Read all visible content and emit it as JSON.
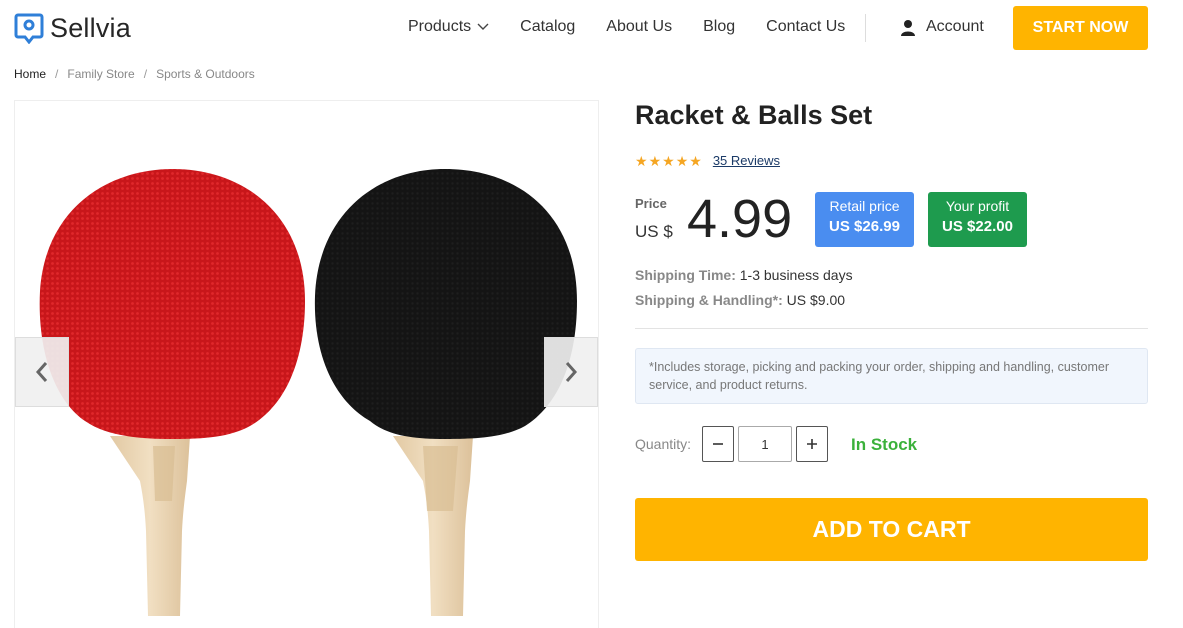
{
  "brand": {
    "name": "Sellvia",
    "color": "#2f7fd8"
  },
  "nav": {
    "items": [
      {
        "label": "Products",
        "has_dropdown": true
      },
      {
        "label": "Catalog"
      },
      {
        "label": "About Us"
      },
      {
        "label": "Blog"
      },
      {
        "label": "Contact Us"
      }
    ],
    "account_label": "Account",
    "start_label": "START NOW"
  },
  "breadcrumb": [
    "Home",
    "Family Store",
    "Sports & Outdoors"
  ],
  "product": {
    "title": "Racket & Balls Set",
    "rating": 5,
    "reviews_label": "35 Reviews",
    "price_label": "Price",
    "currency": "US $",
    "price": "4.99",
    "retail": {
      "label": "Retail price",
      "value": "US $26.99",
      "color": "#4a8df0"
    },
    "profit": {
      "label": "Your profit",
      "value": "US $22.00",
      "color": "#1e9b4e"
    },
    "shipping_time_label": "Shipping Time:",
    "shipping_time_value": "1-3 business days",
    "shipping_handling_label": "Shipping & Handling*:",
    "shipping_handling_value": "US $9.00",
    "note": "*Includes storage, picking and packing your order, shipping and handling, customer service, and product returns.",
    "quantity_label": "Quantity:",
    "quantity_value": "1",
    "stock_label": "In Stock",
    "add_to_cart_label": "ADD TO CART",
    "accent_color": "#ffb400"
  },
  "icons": {
    "logo": "map-pin-icon",
    "chevron": "chevron-down-icon",
    "account": "user-icon",
    "prev": "chevron-left-icon",
    "next": "chevron-right-icon",
    "minus": "minus-icon",
    "plus": "plus-icon",
    "star": "star-icon"
  }
}
